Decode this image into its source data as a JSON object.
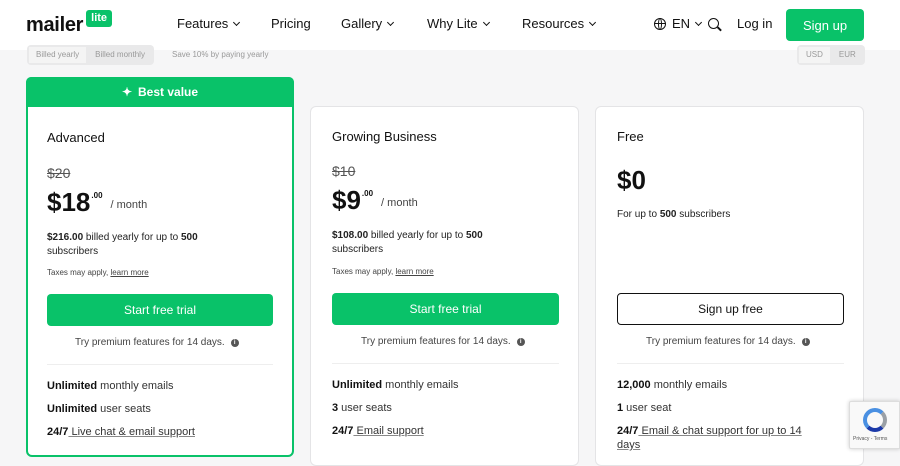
{
  "nav": {
    "logo_text": "mailer",
    "logo_badge": "lite",
    "items": [
      {
        "label": "Features",
        "dropdown": true
      },
      {
        "label": "Pricing",
        "dropdown": false
      },
      {
        "label": "Gallery",
        "dropdown": true
      },
      {
        "label": "Why Lite",
        "dropdown": true
      },
      {
        "label": "Resources",
        "dropdown": true
      }
    ],
    "language": "EN",
    "login": "Log in",
    "signup": "Sign up"
  },
  "billing": {
    "options": [
      "Billed yearly",
      "Billed monthly"
    ],
    "selected": "Billed yearly",
    "save_note": "Save 10% by paying yearly",
    "currencies": [
      "USD",
      "EUR"
    ],
    "selected_currency": "USD"
  },
  "plans": [
    {
      "badge": "Best value",
      "name": "Advanced",
      "old_price": "$20",
      "price": "$18",
      "cents": ".00",
      "period": "/ month",
      "billed_amount": "$216.00",
      "billed_text": " billed yearly for up to ",
      "subscribers": "500",
      "subscribers_suffix": "subscribers",
      "taxes": "Taxes may apply, ",
      "learn_more": "learn more",
      "cta": "Start free trial",
      "trial_note": "Try premium features for 14 days.",
      "features": [
        {
          "bold": "Unlimited",
          "text": " monthly emails"
        },
        {
          "bold": "Unlimited",
          "text": " user seats"
        },
        {
          "bold": "24/7",
          "text": " Live chat & email support"
        }
      ]
    },
    {
      "name": "Growing Business",
      "old_price": "$10",
      "price": "$9",
      "cents": ".00",
      "period": "/ month",
      "billed_amount": "$108.00",
      "billed_text": " billed yearly for up to ",
      "subscribers": "500",
      "subscribers_suffix": "subscribers",
      "taxes": "Taxes may apply, ",
      "learn_more": "learn more",
      "cta": "Start free trial",
      "trial_note": "Try premium features for 14 days.",
      "features": [
        {
          "bold": "Unlimited",
          "text": " monthly emails"
        },
        {
          "bold": "3",
          "text": " user seats"
        },
        {
          "bold": "24/7",
          "text": " Email support"
        }
      ]
    },
    {
      "name": "Free",
      "price": "$0",
      "sub_prefix": "For up to ",
      "subscribers": "500",
      "sub_suffix": " subscribers",
      "cta": "Sign up free",
      "trial_note": "Try premium features for 14 days.",
      "features": [
        {
          "bold": "12,000",
          "text": " monthly emails"
        },
        {
          "bold": "1",
          "text": " user seat"
        },
        {
          "bold": "24/7",
          "text": " Email & chat support for up to 14 days"
        }
      ]
    }
  ],
  "recaptcha": {
    "text": "Privacy - Terms"
  },
  "colors": {
    "accent": "#09c269"
  }
}
